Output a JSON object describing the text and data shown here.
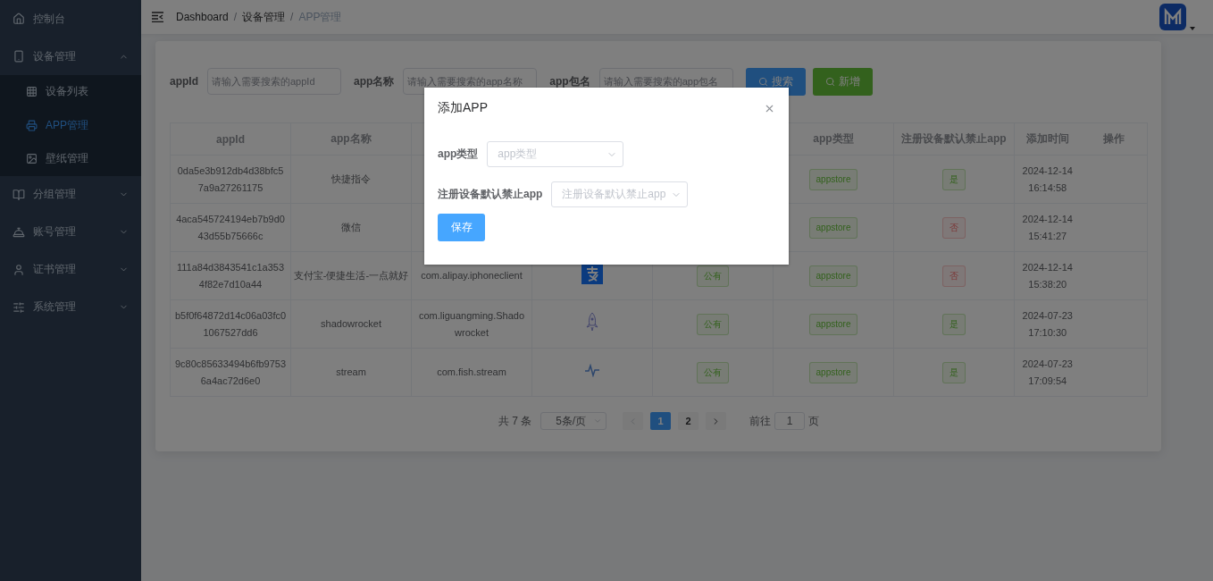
{
  "sidebar": {
    "items": [
      {
        "label": "控制台",
        "selected": false
      },
      {
        "label": "设备管理",
        "selected": false,
        "expanded": true,
        "children": [
          {
            "label": "设备列表",
            "selected": false
          },
          {
            "label": "APP管理",
            "selected": true
          },
          {
            "label": "壁纸管理",
            "selected": false
          }
        ]
      },
      {
        "label": "分组管理",
        "selected": false,
        "expanded": false
      },
      {
        "label": "账号管理",
        "selected": false,
        "expanded": false
      },
      {
        "label": "证书管理",
        "selected": false,
        "expanded": false
      },
      {
        "label": "系统管理",
        "selected": false,
        "expanded": false
      }
    ]
  },
  "breadcrumb": {
    "separator": "/",
    "items": [
      "Dashboard",
      "设备管理",
      "APP管理"
    ]
  },
  "search_form": {
    "fields": [
      {
        "label": "appId",
        "placeholder": "请输入需要搜索的appId"
      },
      {
        "label": "app名称",
        "placeholder": "请输入需要搜索的app名称"
      },
      {
        "label": "app包名",
        "placeholder": "请输入需要搜索的app包名"
      }
    ],
    "buttons": [
      {
        "label": "搜索",
        "kind": "primary"
      },
      {
        "label": "新增",
        "kind": "success"
      }
    ]
  },
  "table": {
    "columns": [
      {
        "label": "appId"
      },
      {
        "label": "app名称"
      },
      {},
      {},
      {},
      {
        "label": "app类型"
      },
      {
        "label": "注册设备默认禁止app"
      },
      {
        "label": "添加时间"
      },
      {
        "label": "操作"
      }
    ],
    "rows": [
      {
        "app_id": "0da5e3b912db4d38bfc5\n7a9a27261175",
        "name": "快捷指令",
        "type": "appstore",
        "ban": {
          "text": "是",
          "on": true
        },
        "time": "2024-12-14\n16:14:58"
      },
      {
        "app_id": "4aca545724194eb7b9d0\n43d55b75666c",
        "name": "微信",
        "type": "appstore",
        "ban": {
          "text": "否",
          "on": false
        },
        "time": "2024-12-14\n15:41:27"
      },
      {
        "app_id": "111a84d3843541c1a353\n4f82e7d10a44",
        "name": "支付宝-便捷生活-一点就好",
        "package": "com.alipay.iphoneclient",
        "icon": {
          "kind": "alipay"
        },
        "scope": "公有",
        "type": "appstore",
        "ban": {
          "text": "否",
          "on": false
        },
        "time": "2024-12-14\n15:38:20"
      },
      {
        "app_id": "b5f0f64872d14c06a03fc0\n1067527dd6",
        "name": "shadowrocket",
        "package": "com.liguangming.Shado\nwrocket",
        "icon": {
          "kind": "rocket"
        },
        "scope": "公有",
        "type": "appstore",
        "ban": {
          "text": "是",
          "on": true
        },
        "time": "2024-07-23\n17:10:30"
      },
      {
        "app_id": "9c80c85633494b6fb9753\n6a4ac72d6e0",
        "name": "stream",
        "package": "com.fish.stream",
        "icon": {
          "kind": "pulse"
        },
        "scope": "公有",
        "type": "appstore",
        "ban": {
          "text": "是",
          "on": true
        },
        "time": "2024-07-23\n17:09:54"
      }
    ]
  },
  "pagination": {
    "total": "共 7 条",
    "page_size": "5条/页",
    "pages": [
      {
        "label": "1",
        "selected": true
      },
      {
        "label": "2",
        "selected": false
      }
    ],
    "goto_label": "前往",
    "goto_value": "1",
    "goto_suffix": "页"
  },
  "dialog": {
    "title": "添加APP",
    "fields": [
      {
        "label": "app类型",
        "placeholder": "app类型"
      },
      {
        "label": "注册设备默认禁止app",
        "placeholder": "注册设备默认禁止app"
      }
    ],
    "save": "保存"
  }
}
